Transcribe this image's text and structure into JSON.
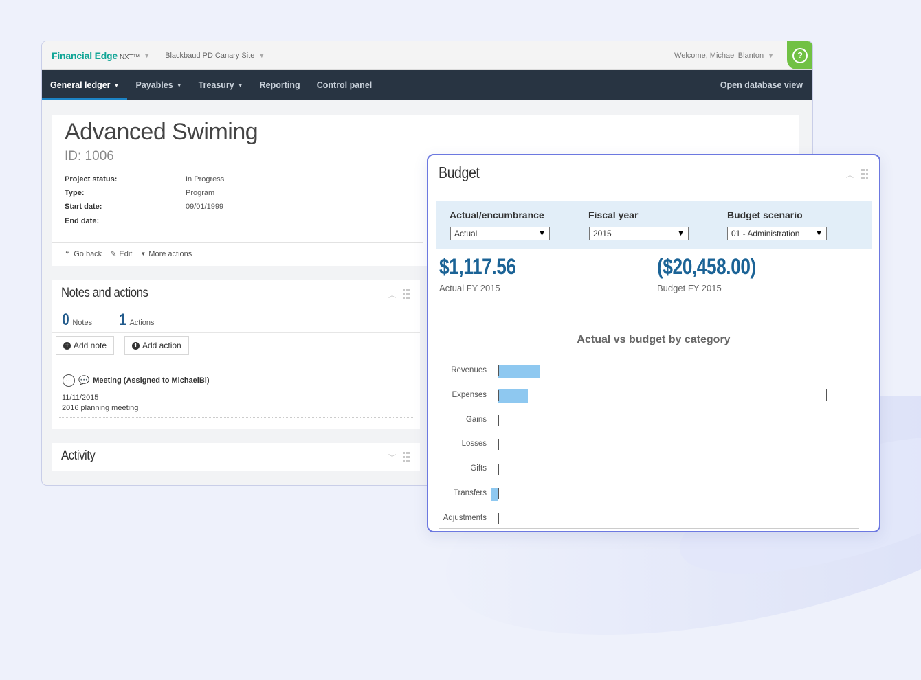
{
  "topbar": {
    "brand": "Financial Edge",
    "brand_suffix": "NXT™",
    "site": "Blackbaud PD Canary Site",
    "welcome": "Welcome, Michael Blanton",
    "help": "?"
  },
  "nav": {
    "items": [
      {
        "label": "General ledger",
        "dropdown": true,
        "active": true
      },
      {
        "label": "Payables",
        "dropdown": true
      },
      {
        "label": "Treasury",
        "dropdown": true
      },
      {
        "label": "Reporting"
      },
      {
        "label": "Control panel"
      }
    ],
    "right": "Open database view"
  },
  "record": {
    "title": "Advanced Swiming",
    "id": "ID: 1006",
    "fields": [
      {
        "label": "Project status:",
        "value": "In Progress"
      },
      {
        "label": "Type:",
        "value": "Program"
      },
      {
        "label": "Start date:",
        "value": "09/01/1999"
      },
      {
        "label": "End date:",
        "value": ""
      }
    ],
    "actions": {
      "back": "Go back",
      "edit": "Edit",
      "more": "More actions"
    }
  },
  "notes": {
    "title": "Notes and actions",
    "notes_count": "0",
    "notes_label": "Notes",
    "actions_count": "1",
    "actions_label": "Actions",
    "add_note": "Add note",
    "add_action": "Add action",
    "item": {
      "title": "Meeting (Assigned to MichaelBl)",
      "date": "11/11/2015",
      "desc": "2016 planning meeting"
    }
  },
  "activity": {
    "title": "Activity"
  },
  "budget": {
    "title": "Budget",
    "filters": [
      {
        "label": "Actual/encumbrance",
        "value": "Actual"
      },
      {
        "label": "Fiscal year",
        "value": "2015"
      },
      {
        "label": "Budget scenario",
        "value": "01 - Administration"
      }
    ],
    "actual_amount": "$1,117.56",
    "actual_label": "Actual FY 2015",
    "budget_amount": "($20,458.00)",
    "budget_label": "Budget FY 2015"
  },
  "chart_data": {
    "type": "bar",
    "title": "Actual vs budget by category",
    "categories": [
      "Revenues",
      "Expenses",
      "Gains",
      "Losses",
      "Gifts",
      "Transfers",
      "Adjustments"
    ],
    "series": [
      {
        "values": [
          1200,
          850,
          0,
          0,
          0,
          -200,
          0
        ]
      }
    ],
    "colors": {
      "bar": "#8ec8f0",
      "axis": "#555555"
    }
  }
}
